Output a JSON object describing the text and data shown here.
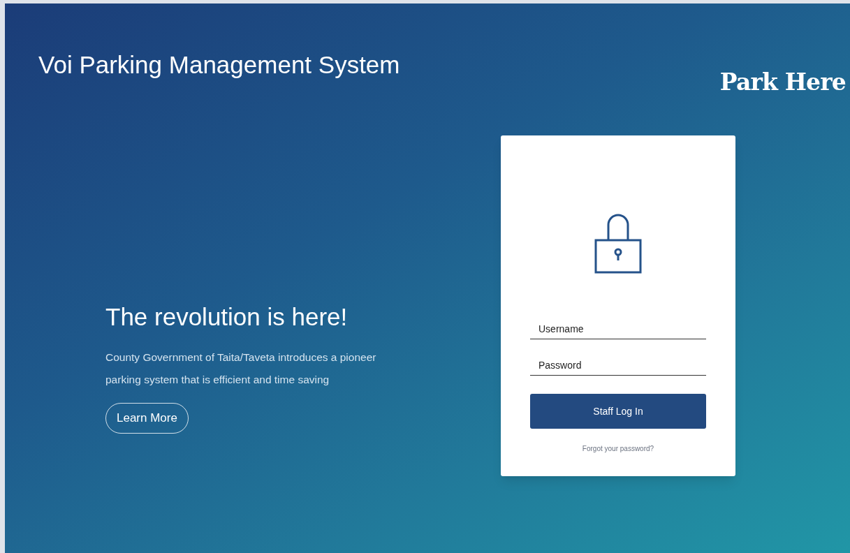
{
  "header": {
    "title": "Voi Parking Management System",
    "brand": "Park Here"
  },
  "hero": {
    "headline": "The revolution is here!",
    "description": "County Government of Taita/Taveta introduces a pioneer parking system that is efficient and time saving",
    "button": "Learn More"
  },
  "login": {
    "fields": [
      {
        "placeholder": "Username"
      },
      {
        "placeholder": "Password"
      }
    ],
    "button": "Staff Log In",
    "link": "Forgot your password?"
  }
}
